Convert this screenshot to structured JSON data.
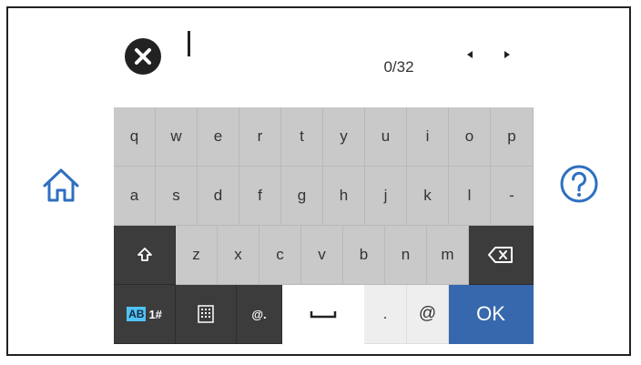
{
  "input": {
    "counter": "0/32"
  },
  "icons": {
    "clear": "close-circle-icon",
    "left": "triangle-left-icon",
    "right": "triangle-right-icon",
    "home": "home-icon",
    "help": "question-circle-icon",
    "shift": "shift-arrow-icon",
    "backspace": "backspace-icon",
    "numpad": "keypad-icon",
    "space": "space-bar-icon"
  },
  "keyboard": {
    "row1": [
      "q",
      "w",
      "e",
      "r",
      "t",
      "y",
      "u",
      "i",
      "o",
      "p"
    ],
    "row2": [
      "a",
      "s",
      "d",
      "f",
      "g",
      "h",
      "j",
      "k",
      "l",
      "-"
    ],
    "row3": [
      "z",
      "x",
      "c",
      "v",
      "b",
      "n",
      "m"
    ],
    "mode_ab": "AB",
    "mode_num": "1#",
    "email_key": "@.",
    "period": ".",
    "at": "@",
    "ok": "OK"
  },
  "colors": {
    "ok_key": "#3768ad",
    "dark_key": "#3c3c3c",
    "letter_key": "#c9c9c9",
    "mode_highlight": "#4fc3f7"
  }
}
